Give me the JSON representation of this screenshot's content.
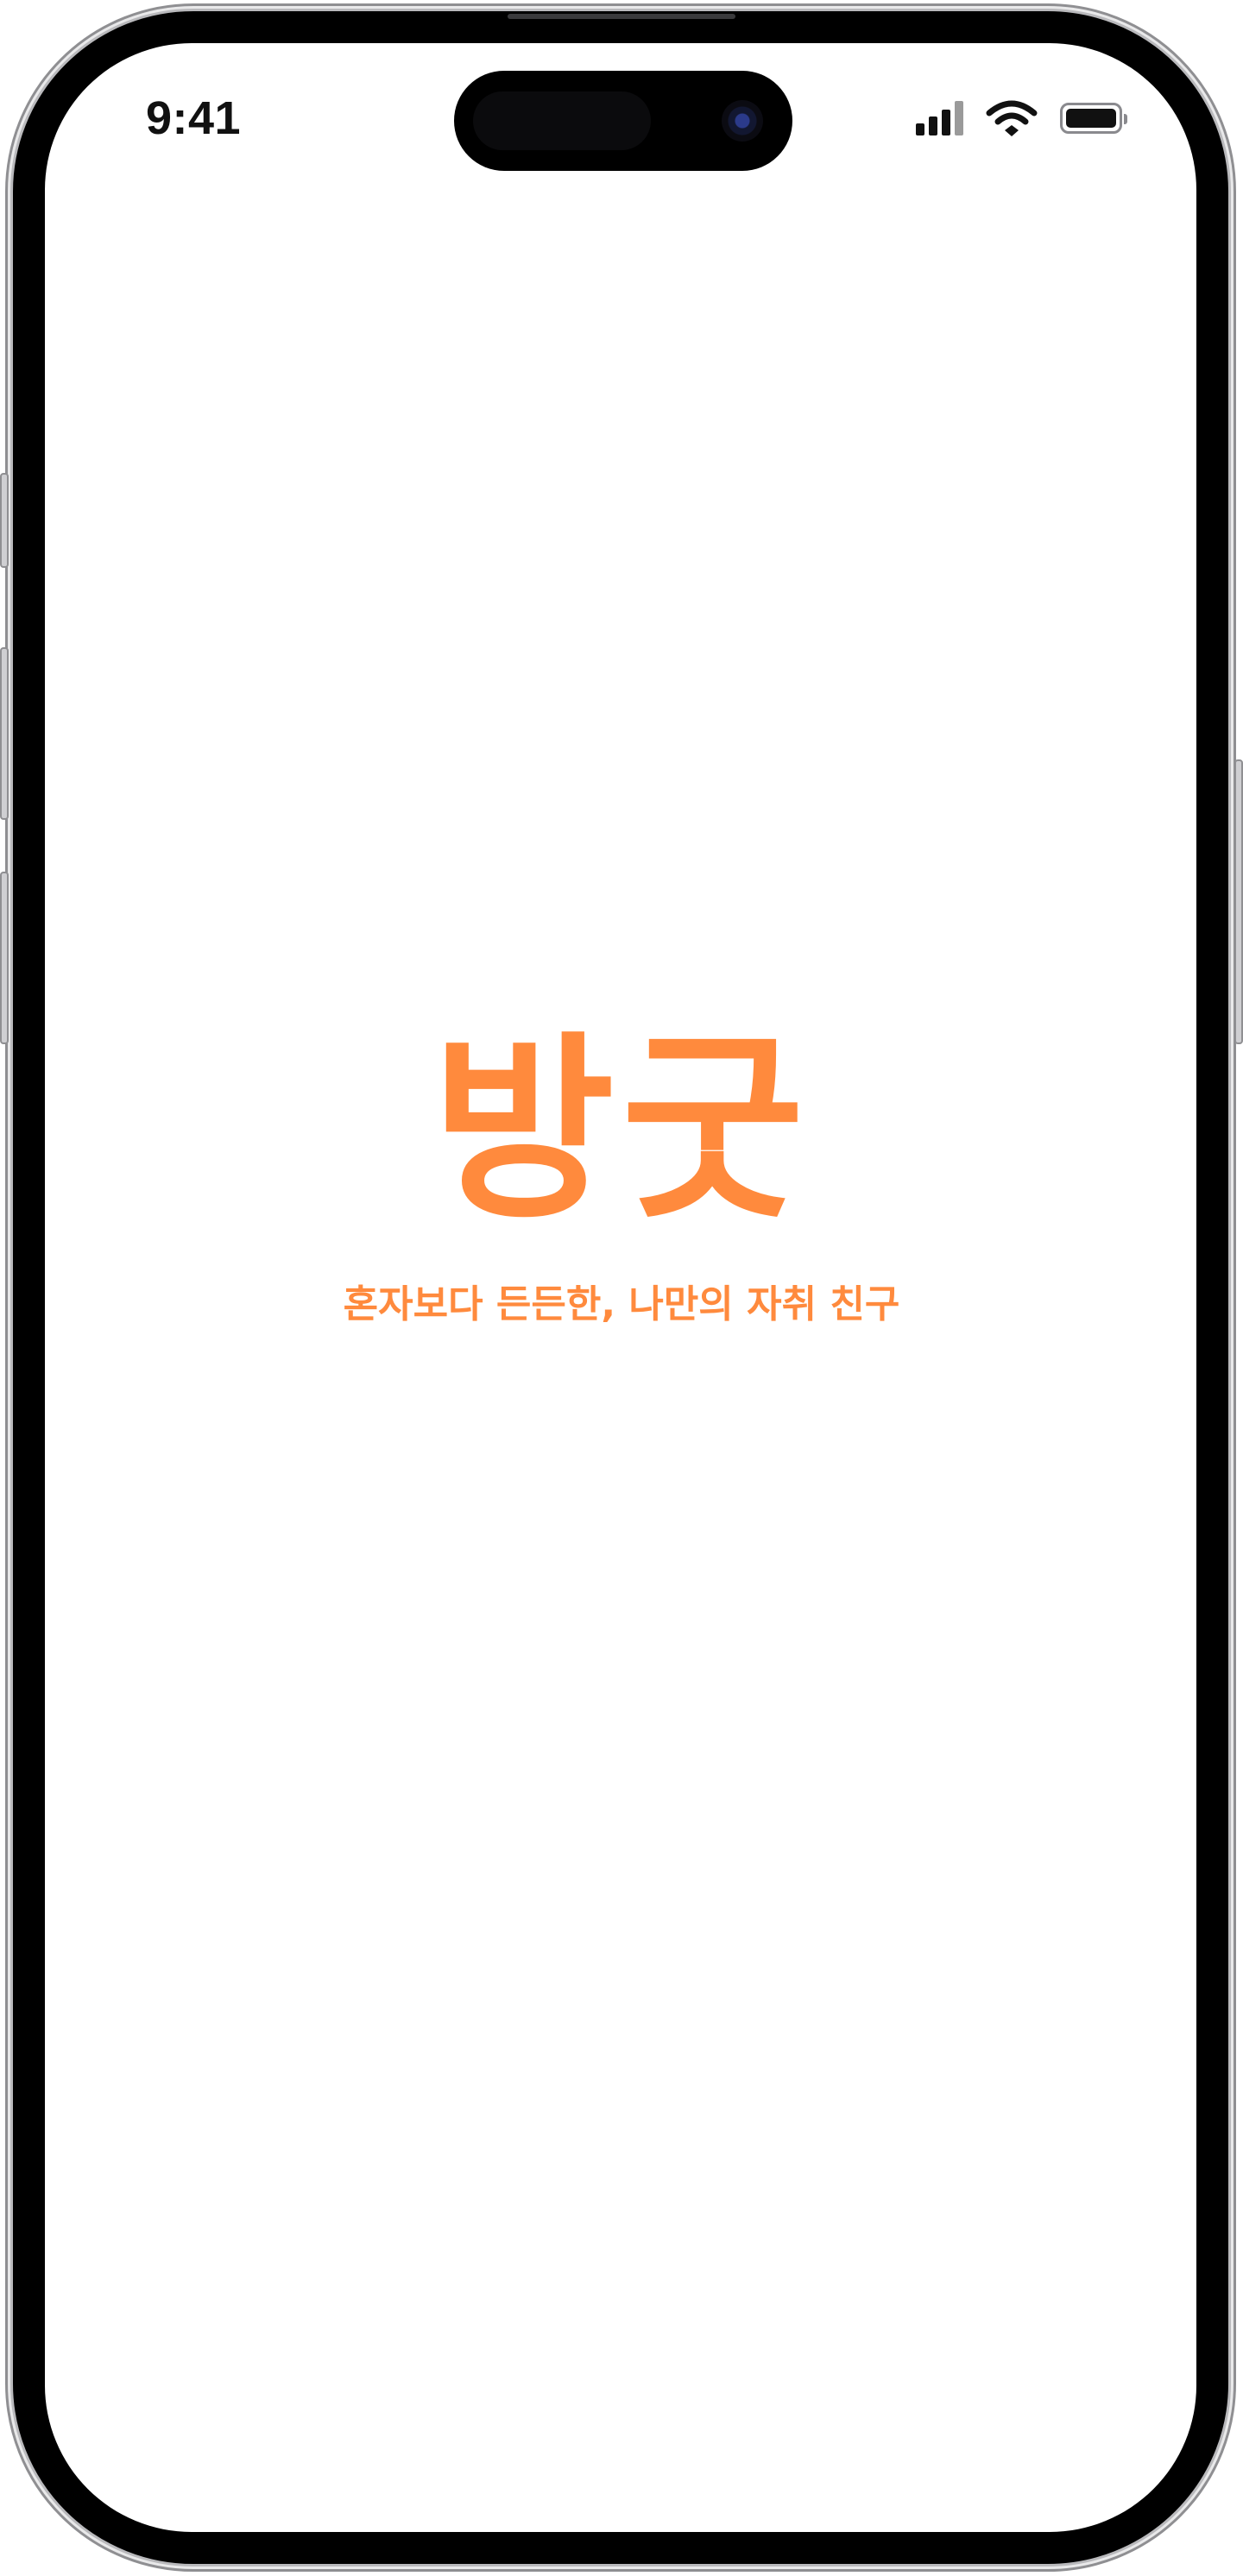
{
  "status_bar": {
    "time": "9:41"
  },
  "splash": {
    "logo_text": "방굿",
    "tagline": "혼자보다 든든한, 나만의 자취 친구"
  },
  "colors": {
    "brand_orange": "#FF8A3D",
    "status_text": "#111111",
    "background": "#FFFFFF",
    "device_frame": "#000000"
  },
  "icons": {
    "signal": "cellular-signal-icon",
    "wifi": "wifi-icon",
    "battery": "battery-icon"
  }
}
